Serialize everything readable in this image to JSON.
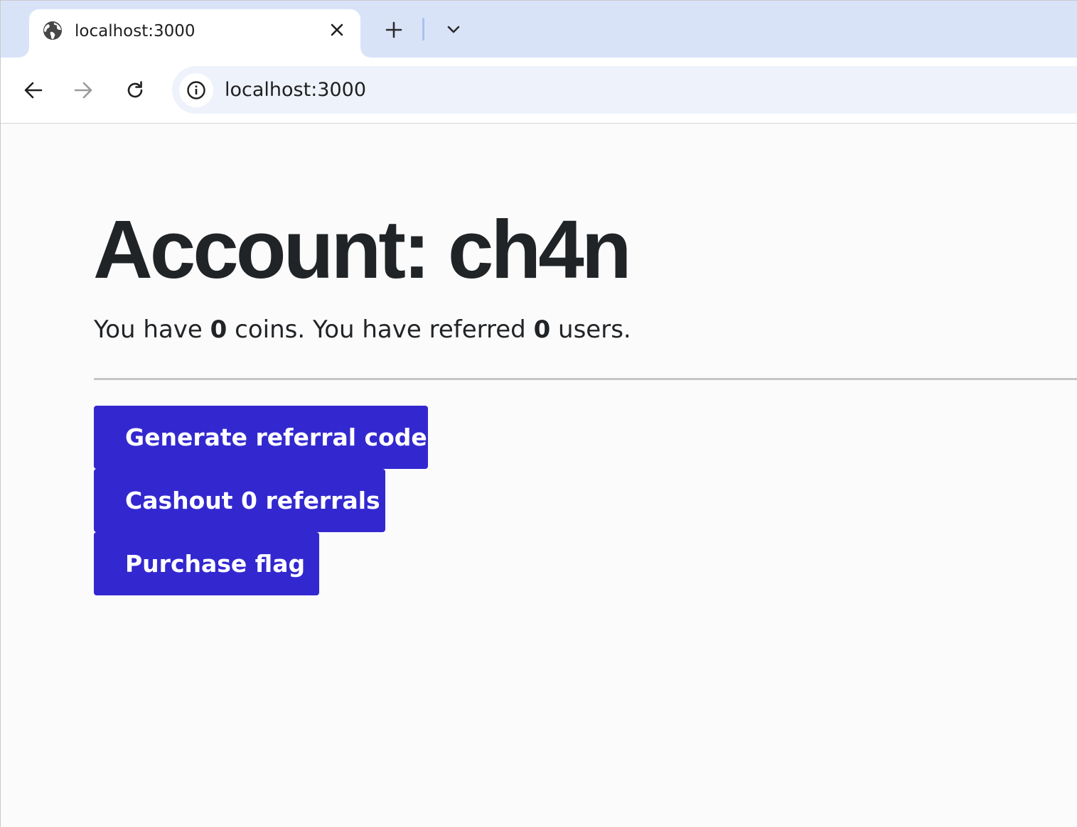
{
  "browser": {
    "tab": {
      "title": "localhost:3000",
      "favicon_icon": "globe-icon"
    },
    "toolbar": {
      "back_icon": "arrow-left-icon",
      "forward_icon": "arrow-right-icon",
      "reload_icon": "reload-icon",
      "site_info_icon": "info-icon",
      "url": "localhost:3000"
    }
  },
  "page": {
    "title": "Account: ch4n",
    "summary": {
      "part1": "You have ",
      "coins": "0",
      "part2": " coins. You have referred ",
      "referred": "0",
      "part3": " users."
    },
    "buttons": {
      "generate": "Generate referral code",
      "cashout": "Cashout 0 referrals",
      "purchase": "Purchase flag"
    }
  },
  "colors": {
    "button_bg": "#3328cf",
    "button_text": "#ffffff",
    "tabstrip_bg": "#d9e3f8",
    "omnibox_bg": "#eef2fb",
    "text": "#212426"
  }
}
